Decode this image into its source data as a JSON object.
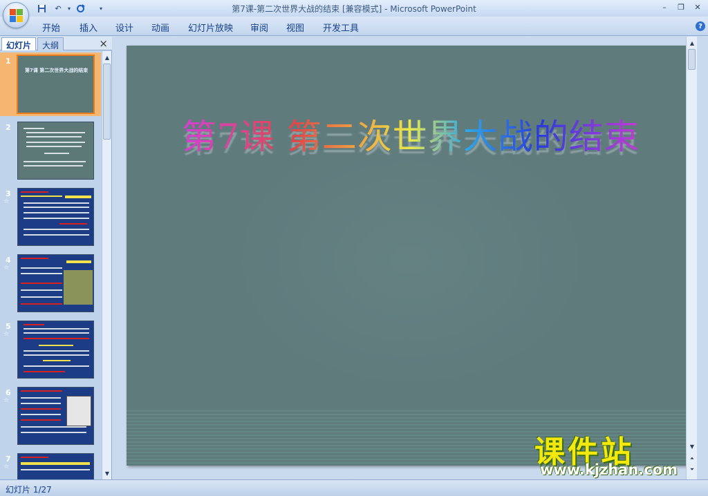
{
  "window": {
    "title": "第7课-第二次世界大战的结束 [兼容模式] - Microsoft PowerPoint",
    "controls": [
      "minimize-icon",
      "restore-icon",
      "close-icon"
    ]
  },
  "quick_access": [
    "save-icon",
    "undo-icon",
    "redo-icon",
    "customize-icon"
  ],
  "ribbon": {
    "tabs": [
      "开始",
      "插入",
      "设计",
      "动画",
      "幻灯片放映",
      "审阅",
      "视图",
      "开发工具"
    ]
  },
  "left_panel": {
    "tabs": [
      "幻灯片",
      "大纲"
    ],
    "close_label": "×",
    "slides": [
      {
        "num": "1",
        "title": "第7课 第二次世界大战的结束",
        "star": ""
      },
      {
        "num": "2",
        "star": ""
      },
      {
        "num": "3",
        "star": "☆"
      },
      {
        "num": "4",
        "star": "☆"
      },
      {
        "num": "5",
        "star": "☆"
      },
      {
        "num": "6",
        "star": "☆"
      },
      {
        "num": "7",
        "star": "☆"
      }
    ]
  },
  "slide": {
    "title": "第7课 第二次世界大战的结束"
  },
  "brand": {
    "name": "课件站",
    "url": "www.kjzhan.com"
  },
  "status": {
    "slide_counter": "幻灯片 1/27"
  },
  "colors": {
    "slide_bg": "#5f7b7c",
    "selection": "#f4b670",
    "brand_yellow": "#f5e80f"
  }
}
